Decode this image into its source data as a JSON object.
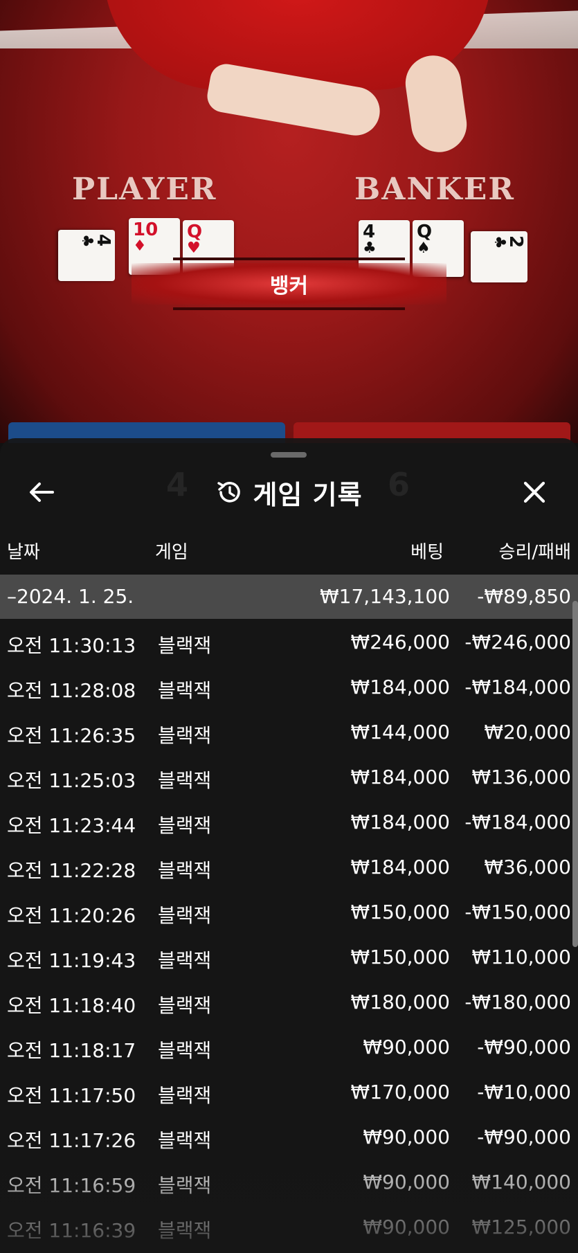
{
  "scene": {
    "player_label": "PLAYER",
    "banker_label": "BANKER",
    "result": "뱅커",
    "player_cards": [
      {
        "rank": "4",
        "suit": "♣",
        "color": "black"
      },
      {
        "rank": "10",
        "suit": "♦",
        "color": "red"
      },
      {
        "rank": "Q",
        "suit": "♥",
        "color": "red"
      }
    ],
    "banker_cards": [
      {
        "rank": "4",
        "suit": "♣",
        "color": "black"
      },
      {
        "rank": "Q",
        "suit": "♠",
        "color": "black"
      },
      {
        "rank": "2",
        "suit": "♣",
        "color": "black"
      }
    ]
  },
  "sheet": {
    "title": "게임 기록",
    "back_icon": "arrow-left-icon",
    "history_icon": "history-icon",
    "close_icon": "close-icon",
    "columns": {
      "date": "날짜",
      "game": "게임",
      "bet": "베팅",
      "win_loss": "승리/패배"
    },
    "summary": {
      "date": "–2024. 1. 25.",
      "bet": "₩17,143,100",
      "win_loss": "-₩89,850"
    },
    "rows": [
      {
        "time": "오전 11:30:13",
        "game": "블랙잭",
        "bet": "₩246,000",
        "win_loss": "-₩246,000"
      },
      {
        "time": "오전 11:28:08",
        "game": "블랙잭",
        "bet": "₩184,000",
        "win_loss": "-₩184,000"
      },
      {
        "time": "오전 11:26:35",
        "game": "블랙잭",
        "bet": "₩144,000",
        "win_loss": "₩20,000"
      },
      {
        "time": "오전 11:25:03",
        "game": "블랙잭",
        "bet": "₩184,000",
        "win_loss": "₩136,000"
      },
      {
        "time": "오전 11:23:44",
        "game": "블랙잭",
        "bet": "₩184,000",
        "win_loss": "-₩184,000"
      },
      {
        "time": "오전 11:22:28",
        "game": "블랙잭",
        "bet": "₩184,000",
        "win_loss": "₩36,000"
      },
      {
        "time": "오전 11:20:26",
        "game": "블랙잭",
        "bet": "₩150,000",
        "win_loss": "-₩150,000"
      },
      {
        "time": "오전 11:19:43",
        "game": "블랙잭",
        "bet": "₩150,000",
        "win_loss": "₩110,000"
      },
      {
        "time": "오전 11:18:40",
        "game": "블랙잭",
        "bet": "₩180,000",
        "win_loss": "-₩180,000"
      },
      {
        "time": "오전 11:18:17",
        "game": "블랙잭",
        "bet": "₩90,000",
        "win_loss": "-₩90,000"
      },
      {
        "time": "오전 11:17:50",
        "game": "블랙잭",
        "bet": "₩170,000",
        "win_loss": "-₩10,000"
      },
      {
        "time": "오전 11:17:26",
        "game": "블랙잭",
        "bet": "₩90,000",
        "win_loss": "-₩90,000"
      },
      {
        "time": "오전 11:16:59",
        "game": "블랙잭",
        "bet": "₩90,000",
        "win_loss": "₩140,000"
      },
      {
        "time": "오전 11:16:39",
        "game": "블랙잭",
        "bet": "₩90,000",
        "win_loss": "₩125,000"
      }
    ]
  }
}
